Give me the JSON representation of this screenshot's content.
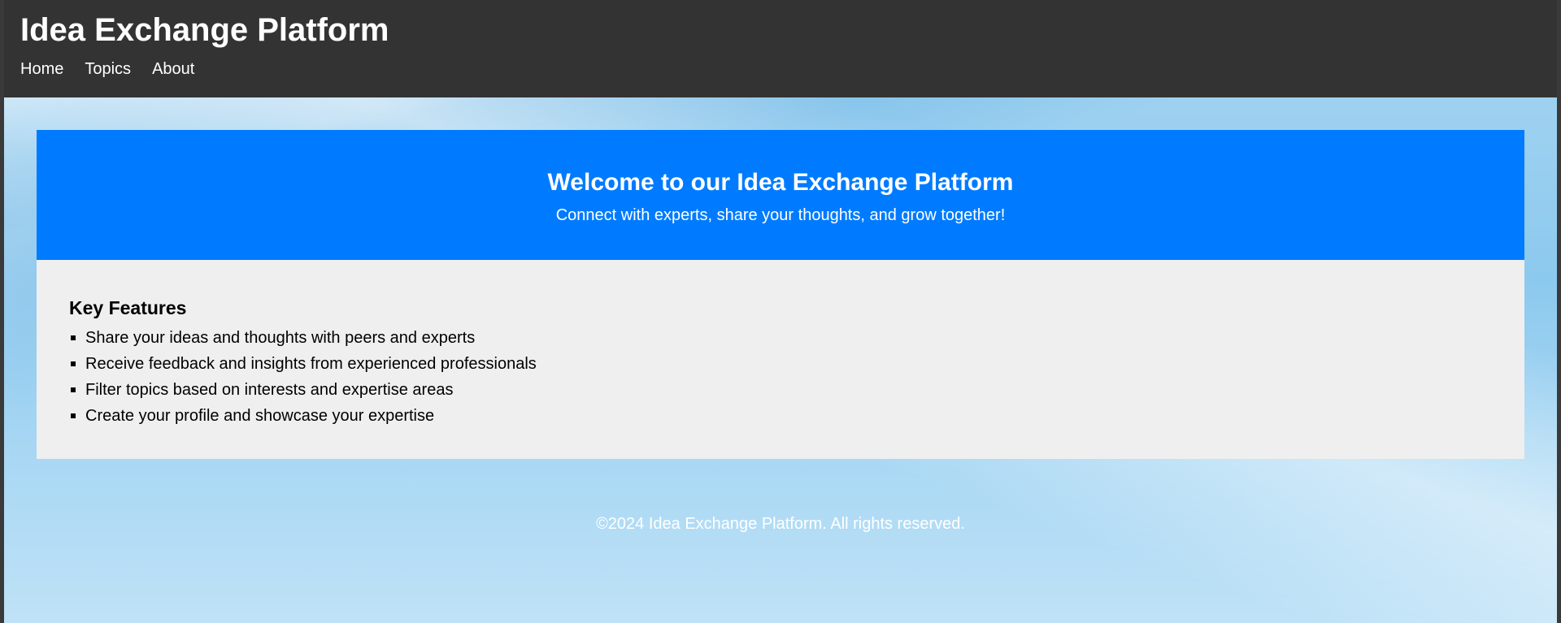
{
  "header": {
    "title": "Idea Exchange Platform",
    "nav": [
      "Home",
      "Topics",
      "About"
    ]
  },
  "hero": {
    "heading": "Welcome to our Idea Exchange Platform",
    "subheading": "Connect with experts, share your thoughts, and grow together!"
  },
  "features": {
    "heading": "Key Features",
    "items": [
      "Share your ideas and thoughts with peers and experts",
      "Receive feedback and insights from experienced professionals",
      "Filter topics based on interests and expertise areas",
      "Create your profile and showcase your expertise"
    ]
  },
  "footer": {
    "text": "©2024 Idea Exchange Platform. All rights reserved."
  },
  "colors": {
    "header_bg": "#333333",
    "hero_bg": "#007bff",
    "features_bg": "#efefef"
  }
}
